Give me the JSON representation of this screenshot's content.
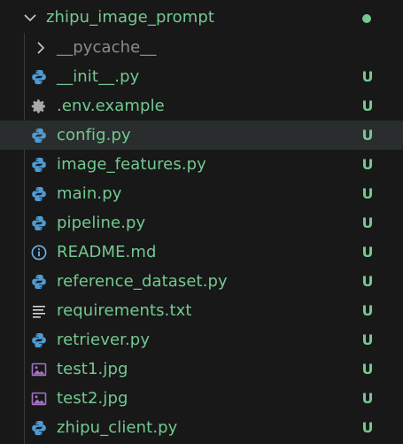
{
  "colors": {
    "background": "#181818",
    "selected_row": "#2a2d2e",
    "untracked_text": "#73c991",
    "ignored_text": "#8c8c8c",
    "python_icon": "#4f9bd3",
    "gear_icon": "#a8a8a8",
    "info_icon": "#6fb1e6",
    "text_file_icon": "#d4d4d4",
    "image_icon": "#a074c4",
    "dot": "#73c991"
  },
  "root_folder": {
    "label": "zhipu_image_prompt",
    "expanded": true,
    "chevron_icon": "chevron-down-icon",
    "status_dot": true
  },
  "items": [
    {
      "label": "__pycache__",
      "type": "folder",
      "icon": "chevron-right-icon",
      "status": ""
    },
    {
      "label": "__init__.py",
      "type": "python",
      "icon": "python-icon",
      "status": "U"
    },
    {
      "label": ".env.example",
      "type": "settings",
      "icon": "gear-icon",
      "status": "U"
    },
    {
      "label": "config.py",
      "type": "python",
      "icon": "python-icon",
      "status": "U",
      "selected": true
    },
    {
      "label": "image_features.py",
      "type": "python",
      "icon": "python-icon",
      "status": "U"
    },
    {
      "label": "main.py",
      "type": "python",
      "icon": "python-icon",
      "status": "U"
    },
    {
      "label": "pipeline.py",
      "type": "python",
      "icon": "python-icon",
      "status": "U"
    },
    {
      "label": "README.md",
      "type": "info",
      "icon": "info-icon",
      "status": "U"
    },
    {
      "label": "reference_dataset.py",
      "type": "python",
      "icon": "python-icon",
      "status": "U"
    },
    {
      "label": "requirements.txt",
      "type": "text",
      "icon": "text-file-icon",
      "status": "U"
    },
    {
      "label": "retriever.py",
      "type": "python",
      "icon": "python-icon",
      "status": "U"
    },
    {
      "label": "test1.jpg",
      "type": "image",
      "icon": "image-icon",
      "status": "U"
    },
    {
      "label": "test2.jpg",
      "type": "image",
      "icon": "image-icon",
      "status": "U"
    },
    {
      "label": "zhipu_client.py",
      "type": "python",
      "icon": "python-icon",
      "status": "U"
    }
  ]
}
